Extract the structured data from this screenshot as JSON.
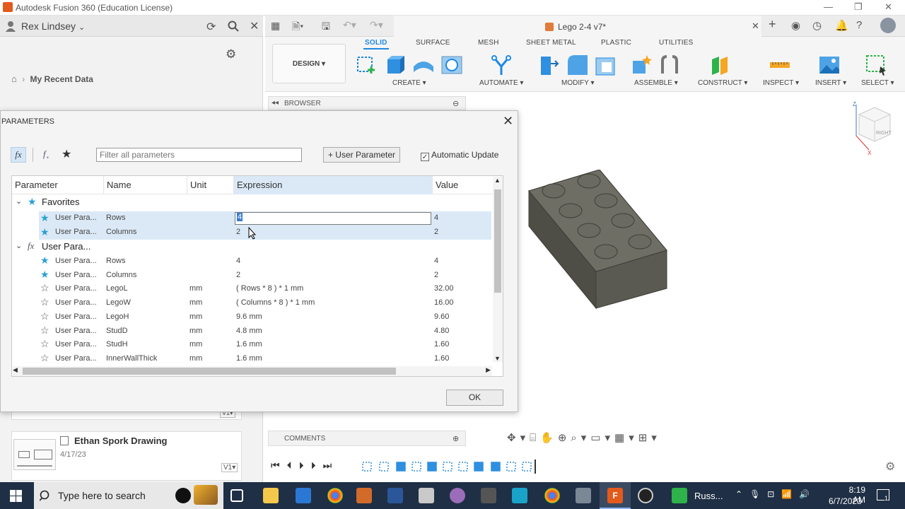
{
  "window": {
    "title": "Autodesk Fusion 360 (Education License)",
    "min": "—",
    "max": "❐",
    "close": "✕"
  },
  "data_panel": {
    "user": "Rex Lindsey",
    "breadcrumb": "My Recent Data",
    "card": {
      "title": "Ethan Spork Drawing",
      "date": "4/17/23",
      "version": "V1▾"
    },
    "card_version_above": "V1▾"
  },
  "document": {
    "tab_title": "Lego 2-4 v7*"
  },
  "ribbon": {
    "workspace": "DESIGN ▾",
    "tabs": [
      "SOLID",
      "SURFACE",
      "MESH",
      "SHEET METAL",
      "PLASTIC",
      "UTILITIES"
    ],
    "active_tab": "SOLID",
    "groups": [
      "CREATE ▾",
      "AUTOMATE ▾",
      "MODIFY ▾",
      "ASSEMBLE ▾",
      "CONSTRUCT ▾",
      "INSPECT ▾",
      "INSERT ▾",
      "SELECT ▾"
    ]
  },
  "browser": {
    "label": "BROWSER"
  },
  "comments": {
    "label": "COMMENTS"
  },
  "viewcube": {
    "face": "RIGHT",
    "axis_z": "Z",
    "axis_x": "X"
  },
  "dialog": {
    "title": "PARAMETERS",
    "filter_placeholder": "Filter all parameters",
    "user_param_button": "+ User Parameter",
    "auto_update_label": "Automatic Update",
    "auto_update_checked": "✓",
    "ok_label": "OK",
    "columns": [
      "Parameter",
      "Name",
      "Unit",
      "Expression",
      "Value"
    ],
    "group_favorites": "Favorites",
    "group_user": "User Para...",
    "favorites": [
      {
        "param": "User Para...",
        "name": "Rows",
        "unit": "",
        "expr": "4",
        "value": "4"
      },
      {
        "param": "User Para...",
        "name": "Columns",
        "unit": "",
        "expr": "2",
        "value": "2"
      }
    ],
    "user_params": [
      {
        "param": "User Para...",
        "name": "Rows",
        "unit": "",
        "expr": "4",
        "value": "4",
        "fav": "★"
      },
      {
        "param": "User Para...",
        "name": "Columns",
        "unit": "",
        "expr": "2",
        "value": "2",
        "fav": "★"
      },
      {
        "param": "User Para...",
        "name": "LegoL",
        "unit": "mm",
        "expr": "( Rows * 8 ) * 1 mm",
        "value": "32.00",
        "fav": "☆"
      },
      {
        "param": "User Para...",
        "name": "LegoW",
        "unit": "mm",
        "expr": "( Columns * 8 ) * 1 mm",
        "value": "16.00",
        "fav": "☆"
      },
      {
        "param": "User Para...",
        "name": "LegoH",
        "unit": "mm",
        "expr": "9.6 mm",
        "value": "9.60",
        "fav": "☆"
      },
      {
        "param": "User Para...",
        "name": "StudD",
        "unit": "mm",
        "expr": "4.8 mm",
        "value": "4.80",
        "fav": "☆"
      },
      {
        "param": "User Para...",
        "name": "StudH",
        "unit": "mm",
        "expr": "1.6 mm",
        "value": "1.60",
        "fav": "☆"
      },
      {
        "param": "User Para...",
        "name": "InnerWallThick",
        "unit": "mm",
        "expr": "1.6 mm",
        "value": "1.60",
        "fav": "☆"
      }
    ]
  },
  "taskbar": {
    "search_placeholder": "Type here to search",
    "app_label": "Russ...",
    "time": "8:19 AM",
    "date": "6/7/2023",
    "notif_count": "1"
  },
  "colors": {
    "accent": "#1e88e5",
    "brick": "#5f5e55",
    "taskbar": "#1f2f45"
  }
}
